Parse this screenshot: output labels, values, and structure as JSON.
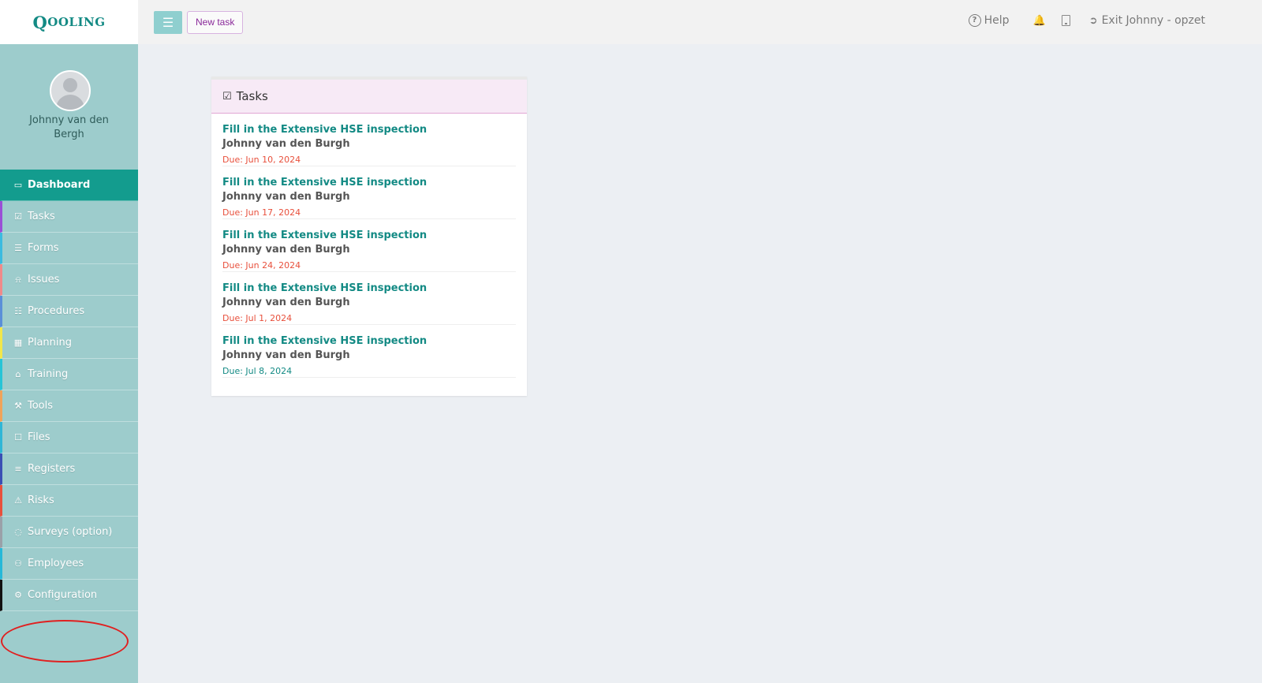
{
  "logo": {
    "first": "Q",
    "rest": "OOLING"
  },
  "profile": {
    "name": "Johnny van den Bergh"
  },
  "nav": {
    "items": [
      {
        "label": "Dashboard",
        "icon": "monitor-icon",
        "color": "#139c8e",
        "active": true
      },
      {
        "label": "Tasks",
        "icon": "check-square-icon",
        "color": "#9a4fd6",
        "active": false
      },
      {
        "label": "Forms",
        "icon": "document-icon",
        "color": "#3bbbe0",
        "active": false
      },
      {
        "label": "Issues",
        "icon": "bell-icon",
        "color": "#f08a8a",
        "active": false
      },
      {
        "label": "Procedures",
        "icon": "list-alt-icon",
        "color": "#5a8fd8",
        "active": false
      },
      {
        "label": "Planning",
        "icon": "calendar-icon",
        "color": "#f2e74a",
        "active": false
      },
      {
        "label": "Training",
        "icon": "graduation-cap-icon",
        "color": "#27c4d6",
        "active": false
      },
      {
        "label": "Tools",
        "icon": "wrench-icon",
        "color": "#f0a35a",
        "active": false
      },
      {
        "label": "Files",
        "icon": "file-icon",
        "color": "#2fb6d6",
        "active": false
      },
      {
        "label": "Registers",
        "icon": "list-icon",
        "color": "#3a4fb4",
        "active": false
      },
      {
        "label": "Risks",
        "icon": "warning-icon",
        "color": "#e8503c",
        "active": false
      },
      {
        "label": "Surveys (option)",
        "icon": "comment-icon",
        "color": "#9aa0a8",
        "active": false
      },
      {
        "label": "Employees",
        "icon": "users-icon",
        "color": "#26b8d8",
        "active": false
      },
      {
        "label": "Configuration",
        "icon": "gear-icon",
        "color": "#111111",
        "active": false
      }
    ]
  },
  "topbar": {
    "menu_icon": "hamburger-icon",
    "new_task_label": "New task",
    "help_label": "Help",
    "exit_label": "Exit Johnny - opzet"
  },
  "tasks_panel": {
    "title": "Tasks",
    "items": [
      {
        "title": "Fill in the Extensive HSE inspection",
        "user": "Johnny van den Burgh",
        "due": "Due: Jun 10, 2024",
        "overdue": true
      },
      {
        "title": "Fill in the Extensive HSE inspection",
        "user": "Johnny van den Burgh",
        "due": "Due: Jun 17, 2024",
        "overdue": true
      },
      {
        "title": "Fill in the Extensive HSE inspection",
        "user": "Johnny van den Burgh",
        "due": "Due: Jun 24, 2024",
        "overdue": true
      },
      {
        "title": "Fill in the Extensive HSE inspection",
        "user": "Johnny van den Burgh",
        "due": "Due: Jul 1, 2024",
        "overdue": true
      },
      {
        "title": "Fill in the Extensive HSE inspection",
        "user": "Johnny van den Burgh",
        "due": "Due: Jul 8, 2024",
        "overdue": false
      }
    ]
  },
  "colors": {
    "brand": "#138a84",
    "sidebar": "#9dcccc",
    "active": "#139c8e",
    "overdue": "#e8503c",
    "annotation": "#e02020"
  }
}
